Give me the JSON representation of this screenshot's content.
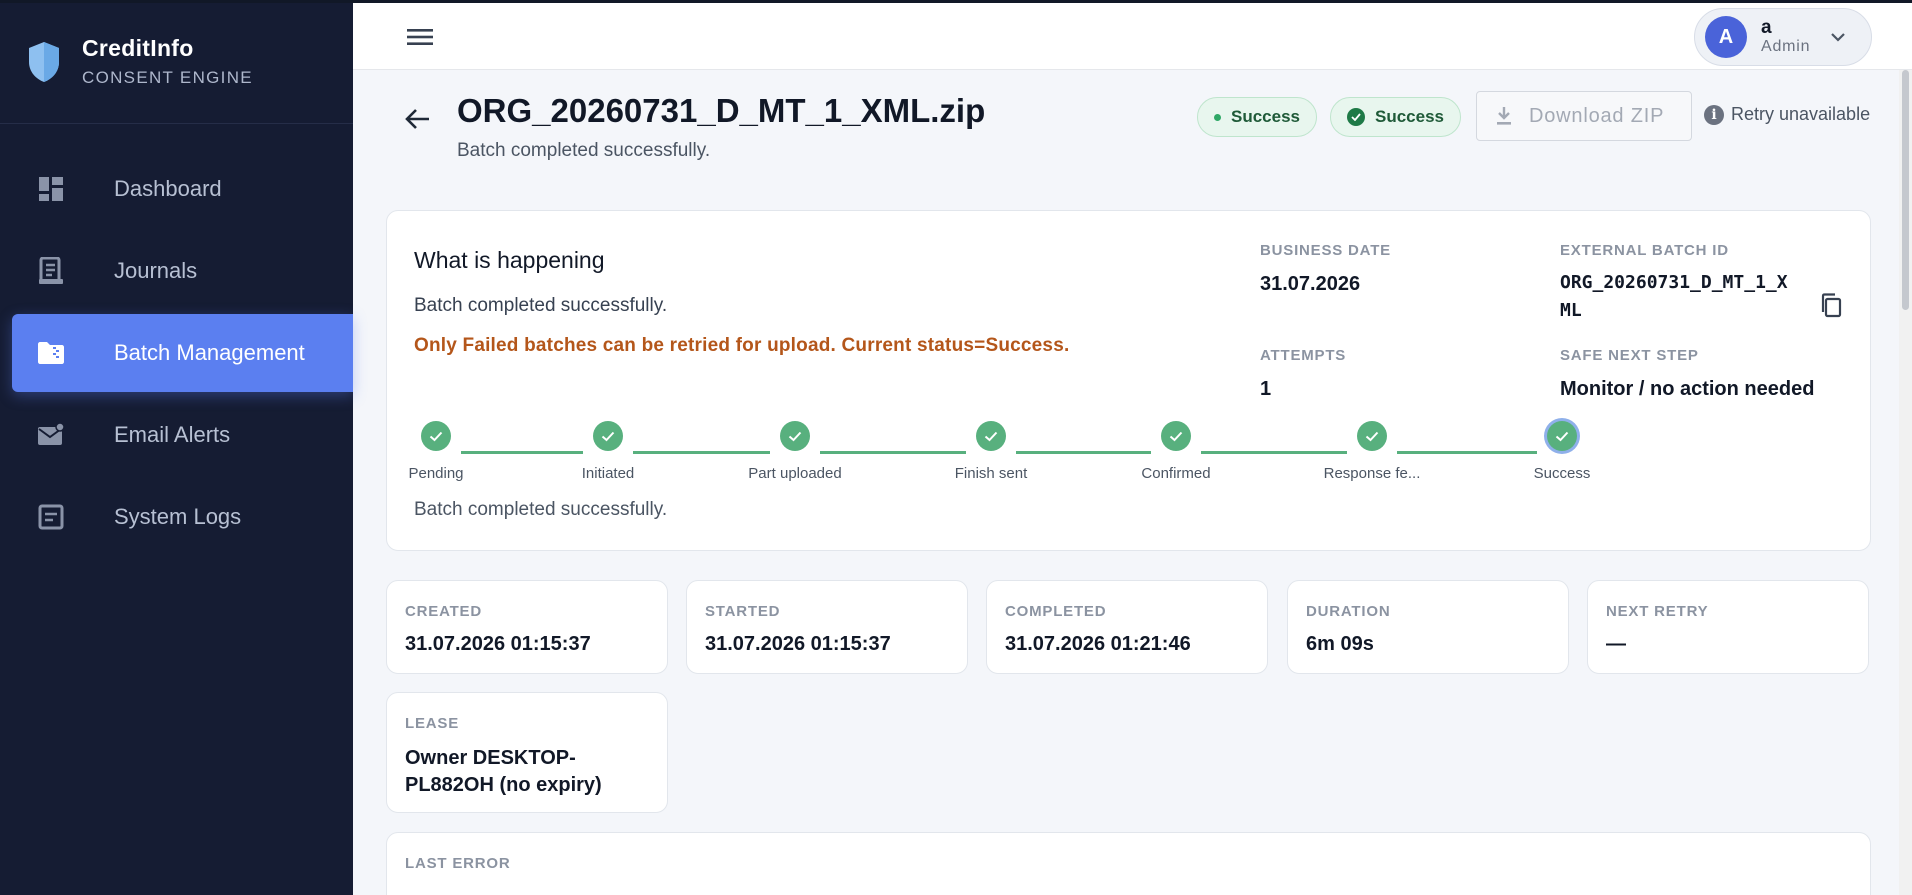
{
  "brand": {
    "name": "CreditInfo",
    "subtitle": "CONSENT ENGINE"
  },
  "sidebar": {
    "items": [
      {
        "label": "Dashboard",
        "icon": "dashboard-icon",
        "active": false
      },
      {
        "label": "Journals",
        "icon": "journal-icon",
        "active": false
      },
      {
        "label": "Batch Management",
        "icon": "folder-zip-icon",
        "active": true
      },
      {
        "label": "Email Alerts",
        "icon": "mail-alert-icon",
        "active": false
      },
      {
        "label": "System Logs",
        "icon": "log-icon",
        "active": false
      }
    ]
  },
  "user": {
    "initial": "A",
    "name": "a",
    "role": "Admin"
  },
  "header": {
    "title": "ORG_20260731_D_MT_1_XML.zip",
    "subtitle": "Batch completed successfully.",
    "status_pill_1": "Success",
    "status_pill_2": "Success",
    "download_label": "Download ZIP",
    "retry_label": "Retry unavailable"
  },
  "status_card": {
    "title": "What is happening",
    "text": "Batch completed successfully.",
    "warning": "Only Failed batches can be retried for upload. Current status=Success.",
    "business_date_label": "BUSINESS DATE",
    "business_date": "31.07.2026",
    "external_batch_id_label": "EXTERNAL BATCH ID",
    "external_batch_id_line1": "ORG_20260731_D_MT_1_X",
    "external_batch_id_line2": "ML",
    "attempts_label": "ATTEMPTS",
    "attempts": "1",
    "next_step_label": "SAFE NEXT STEP",
    "next_step": "Monitor / no action needed",
    "steps": [
      "Pending",
      "Initiated",
      "Part uploaded",
      "Finish sent",
      "Confirmed",
      "Response fe...",
      "Success"
    ],
    "current_step": 6,
    "footer": "Batch completed successfully."
  },
  "stats": [
    {
      "label": "CREATED",
      "value": "31.07.2026 01:15:37"
    },
    {
      "label": "STARTED",
      "value": "31.07.2026 01:15:37"
    },
    {
      "label": "COMPLETED",
      "value": "31.07.2026 01:21:46"
    },
    {
      "label": "DURATION",
      "value": "6m 09s"
    },
    {
      "label": "NEXT RETRY",
      "value": "—"
    }
  ],
  "lease": {
    "label": "LEASE",
    "value": "Owner DESKTOP-PL882OH (no expiry)"
  },
  "last_error": {
    "label": "LAST ERROR"
  },
  "colors": {
    "sidebar_bg": "#151c33",
    "active_nav": "#5b7ff0",
    "success": "#58b07e",
    "warning_text": "#b4561a"
  }
}
